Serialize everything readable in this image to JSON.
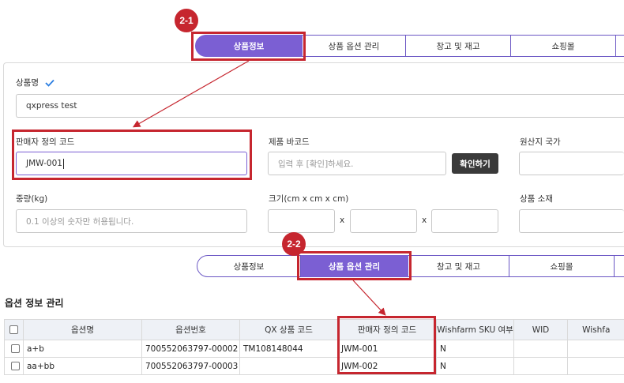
{
  "callouts": {
    "first": "2-1",
    "second": "2-2"
  },
  "top_tabs": [
    "상품정보",
    "상품 옵션 관리",
    "창고 및 재고",
    "쇼핑몰"
  ],
  "product_form": {
    "name_label": "상품명",
    "name_value": "qxpress test",
    "seller_code_label": "판매자 정의 코드",
    "seller_code_value": "JMW-001",
    "barcode_label": "제품 바코드",
    "barcode_placeholder": "입력 후 [확인]하세요.",
    "confirm_button": "확인하기",
    "origin_label": "원산지 국가",
    "weight_label": "중량(kg)",
    "weight_placeholder": "0.1 이상의 숫자만 허용됩니다.",
    "size_label": "크기(cm x cm x cm)",
    "size_sep": "x",
    "material_label": "상품 소재"
  },
  "lower_tabs": [
    "상품정보",
    "상품 옵션 관리",
    "창고 및 재고",
    "쇼핑몰"
  ],
  "options": {
    "title": "옵션 정보 관리",
    "columns": [
      "옵션명",
      "옵션번호",
      "QX 상품 코드",
      "판매자 정의 코드",
      "Wishfarm SKU 여부",
      "WID",
      "Wishfa"
    ],
    "rows": [
      {
        "name": "a+b",
        "number": "700552063797-00002",
        "qx": "TM108148044",
        "seller": "JWM-001",
        "sku": "N",
        "wid": "",
        "extra": ""
      },
      {
        "name": "aa+bb",
        "number": "700552063797-00003",
        "qx": "",
        "seller": "JWM-002",
        "sku": "N",
        "wid": "",
        "extra": ""
      }
    ]
  },
  "colors": {
    "accent": "#7b5fd3",
    "callout": "#c6262f",
    "check": "#2a7de1"
  }
}
